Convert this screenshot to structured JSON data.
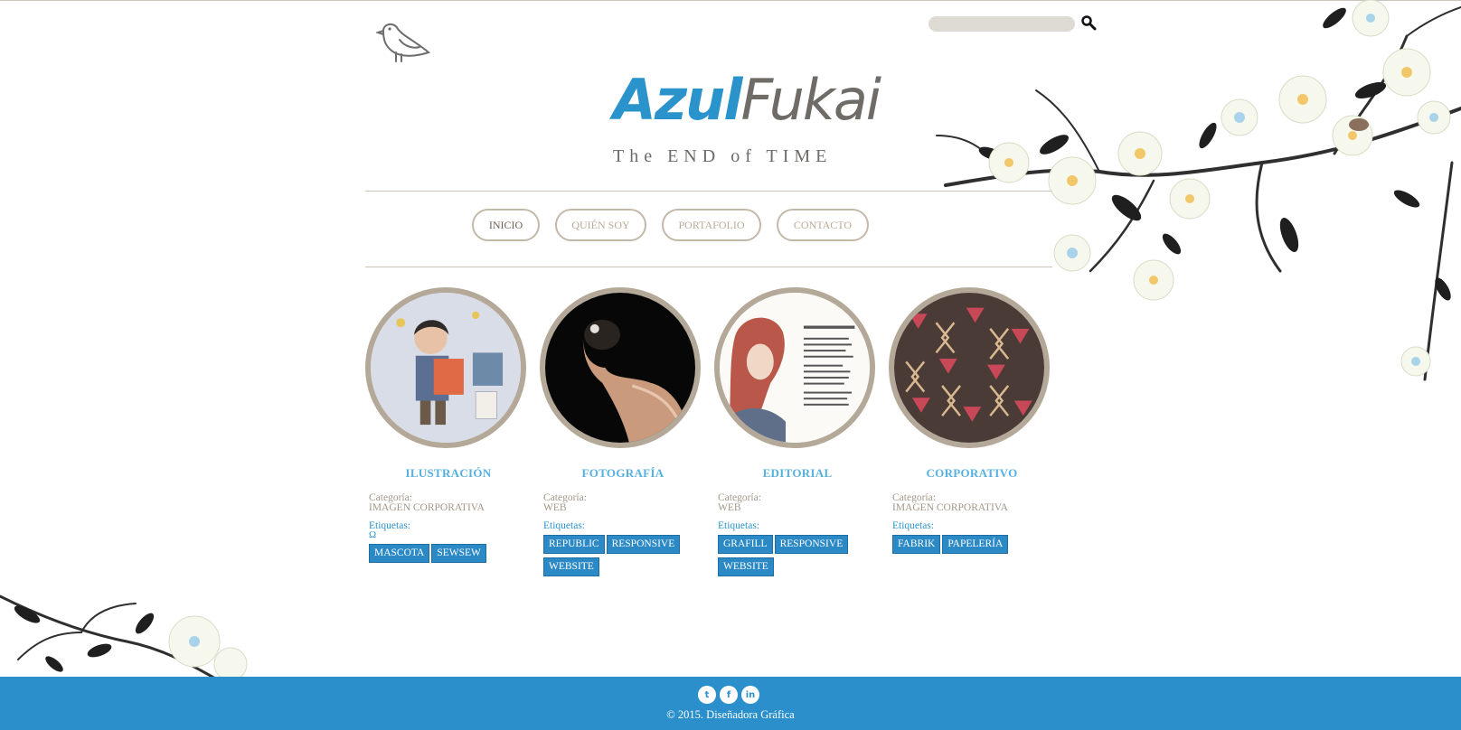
{
  "search": {
    "placeholder": "",
    "value": ""
  },
  "logo": {
    "part1": "Azul",
    "part2": "Fukai",
    "tagline": "The END of TIME"
  },
  "nav": [
    {
      "label": "INICIO",
      "active": true
    },
    {
      "label": "QUIÉN SOY",
      "active": false
    },
    {
      "label": "PORTAFOLIO",
      "active": false
    },
    {
      "label": "CONTACTO",
      "active": false
    }
  ],
  "labels": {
    "category": "Categoría:",
    "tags": "Etiquetas:"
  },
  "portfolio": [
    {
      "title": "ILUSTRACIÓN",
      "category": "IMAGEN CORPORATIVA",
      "extra": "Ω",
      "tags": [
        "MASCOTA",
        "SEWSEW"
      ]
    },
    {
      "title": "FOTOGRAFÍA",
      "category": "WEB",
      "extra": "",
      "tags": [
        "REPUBLIC",
        "RESPONSIVE",
        "WEBSITE"
      ]
    },
    {
      "title": "EDITORIAL",
      "category": "WEB",
      "extra": "",
      "tags": [
        "GRAFILL",
        "RESPONSIVE",
        "WEBSITE"
      ]
    },
    {
      "title": "CORPORATIVO",
      "category": "IMAGEN CORPORATIVA",
      "extra": "",
      "tags": [
        "FABRIK",
        "PAPELERÍA"
      ]
    }
  ],
  "footer": {
    "socials": [
      {
        "icon": "twitter-icon",
        "glyph": "t"
      },
      {
        "icon": "facebook-icon",
        "glyph": "f"
      },
      {
        "icon": "linkedin-icon",
        "glyph": "in"
      }
    ],
    "copyright": "© 2015. Diseñadora Gráfica"
  },
  "colors": {
    "accent": "#2b8fcb",
    "tag": "#2b89c5",
    "title": "#55b1df",
    "muted": "#a39787",
    "ring": "#b4a898"
  }
}
